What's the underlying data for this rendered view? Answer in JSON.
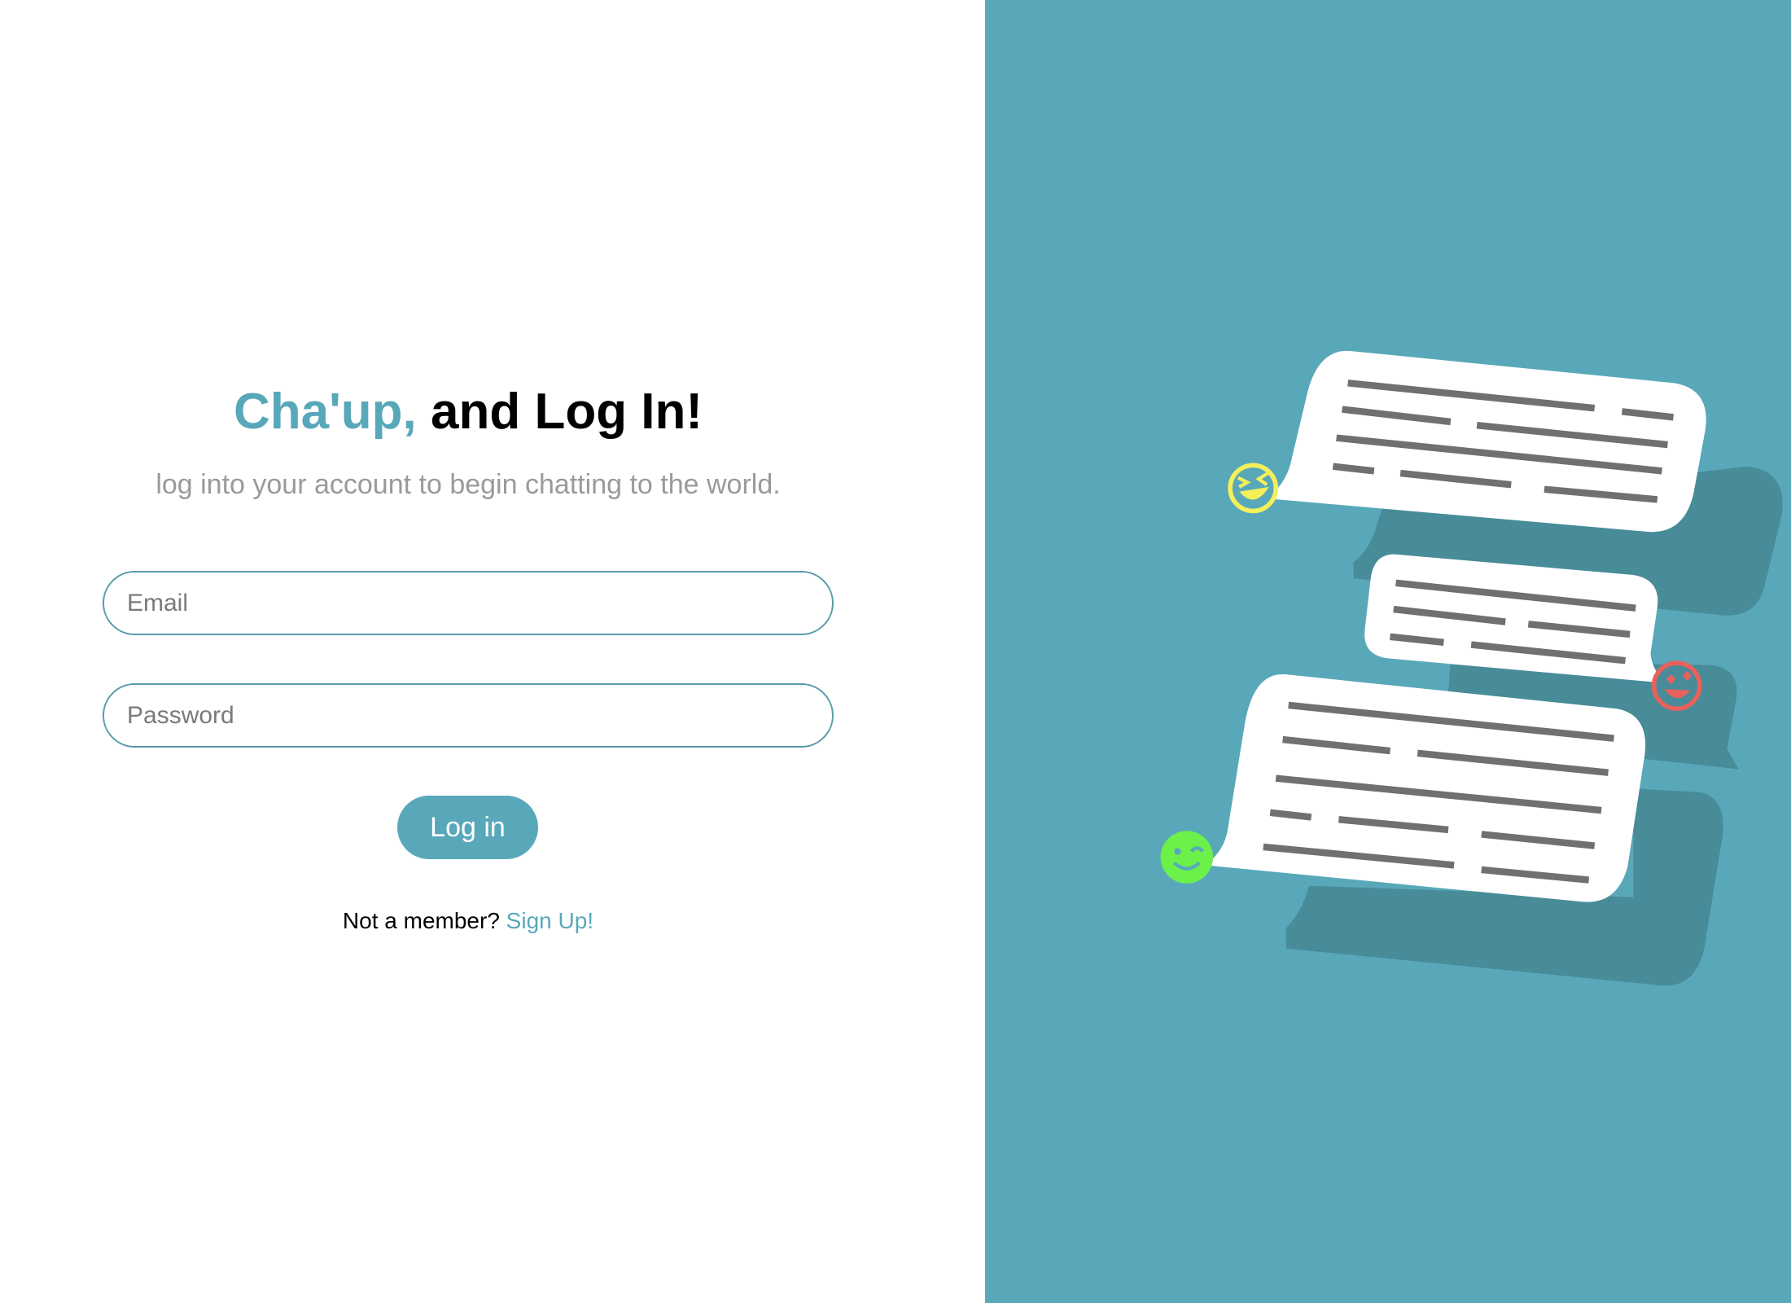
{
  "header": {
    "brand": "Cha'up,",
    "title_rest": "and Log In!",
    "subtitle": "log into your account to begin chatting to the world."
  },
  "form": {
    "email_placeholder": "Email",
    "password_placeholder": "Password",
    "login_label": "Log in"
  },
  "footer": {
    "prompt": "Not a member?",
    "signup_label": "Sign Up!"
  },
  "illustration": {
    "icons": [
      "laughing-emoji-icon",
      "heart-eyes-emoji-icon",
      "winking-emoji-icon"
    ]
  },
  "colors": {
    "accent": "#58a8ba",
    "shadow": "#488b99",
    "line": "#707070",
    "emoji_yellow": "#f4f05a",
    "emoji_red": "#e8615a",
    "emoji_green": "#6cf04a"
  }
}
